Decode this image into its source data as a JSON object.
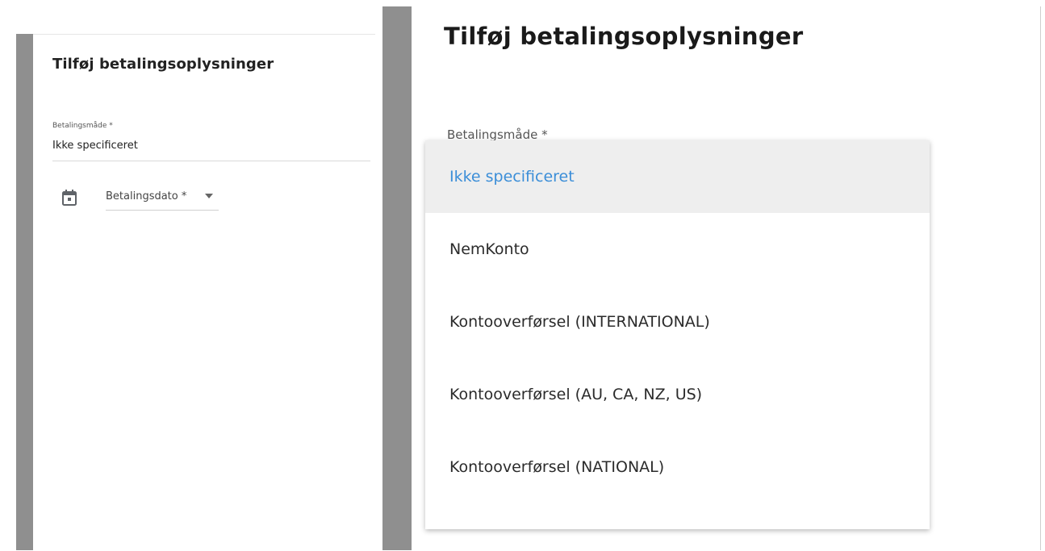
{
  "left_panel": {
    "title": "Tilføj betalingsoplysninger",
    "payment_method": {
      "label": "Betalingsmåde *",
      "value": "Ikke specificeret"
    },
    "payment_date": {
      "label": "Betalingsdato *",
      "icon": "calendar-icon"
    }
  },
  "right_panel": {
    "title": "Tilføj betalingsoplysninger",
    "partial_label": "Betalingsmåde *",
    "dropdown": {
      "options": [
        {
          "label": "Ikke specificeret",
          "selected": true
        },
        {
          "label": "NemKonto",
          "selected": false
        },
        {
          "label": "Kontooverførsel (INTERNATIONAL)",
          "selected": false
        },
        {
          "label": "Kontooverførsel (AU, CA, NZ, US)",
          "selected": false
        },
        {
          "label": "Kontooverførsel (NATIONAL)",
          "selected": false
        }
      ]
    }
  },
  "colors": {
    "accent": "#3b8ed8",
    "sidebar_strip": "#8f8f8f",
    "selected_bg": "#eeeeee"
  }
}
